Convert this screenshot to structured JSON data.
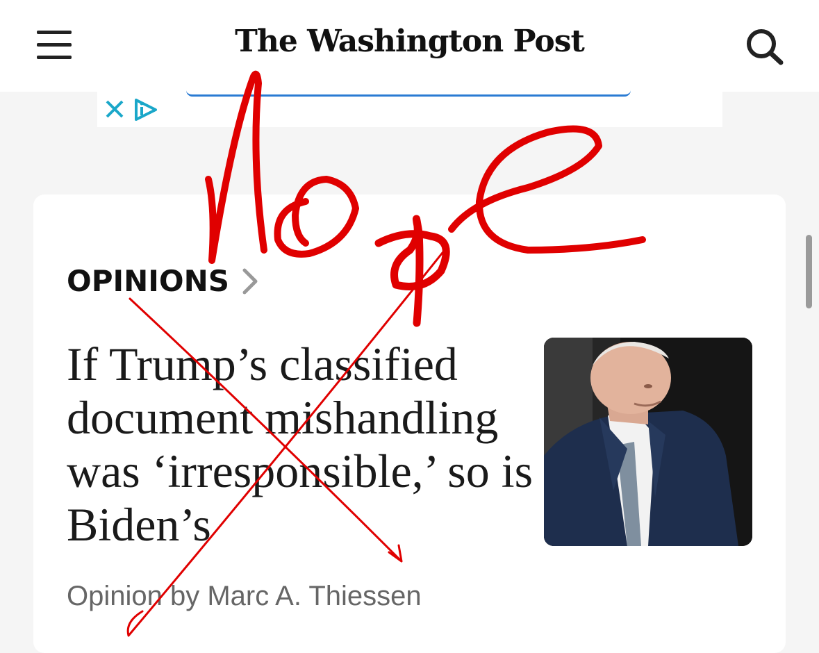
{
  "header": {
    "masthead": "The Washington Post",
    "menu_icon": "hamburger-menu-icon",
    "search_icon": "search-icon"
  },
  "ad": {
    "close_icon": "close-icon",
    "info_icon": "ad-choices-icon",
    "accent_color": "#2a7bd3"
  },
  "article": {
    "section": "OPINIONS",
    "section_chevron_icon": "chevron-right-icon",
    "headline": "If Trump’s classified document mishandling was ‘irresponsible,’ so is Biden’s",
    "byline": "Opinion by Marc A. Thiessen",
    "photo": "photo of man in suit looking down"
  },
  "annotation": {
    "handwritten_text": "Nope",
    "color": "#e00000"
  }
}
